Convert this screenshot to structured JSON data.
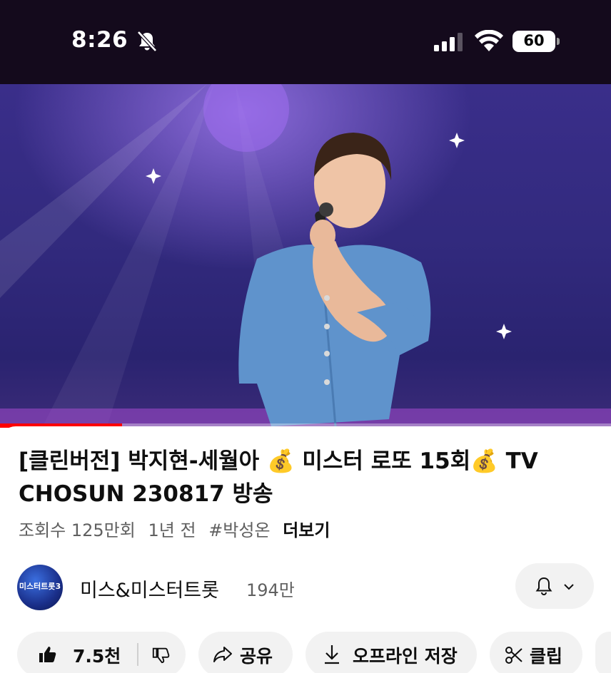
{
  "status_bar": {
    "time": "8:26",
    "battery": "60",
    "icons": [
      "bell-off-icon",
      "cellular-signal-icon",
      "wifi-icon",
      "battery-icon"
    ]
  },
  "video": {
    "progress": 0.2
  },
  "title": "[클린버전] 박지현-세월아 💰 미스터 로또 15회💰 TV CHOSUN 230817 방송",
  "meta": {
    "views": "조회수 125만회",
    "age": "1년 전",
    "hashtag": "#박성온",
    "more": "더보기"
  },
  "channel": {
    "name": "미스&미스터트롯",
    "subscribers": "194만",
    "avatar_text": "미스터트롯3"
  },
  "actions": {
    "like_count": "7.5천",
    "share": "공유",
    "download": "오프라인 저장",
    "clip": "클립"
  },
  "colors": {
    "accent": "#ff0000",
    "pill_bg": "#f2f2f2",
    "status_bar_bg": "#140a1c"
  }
}
